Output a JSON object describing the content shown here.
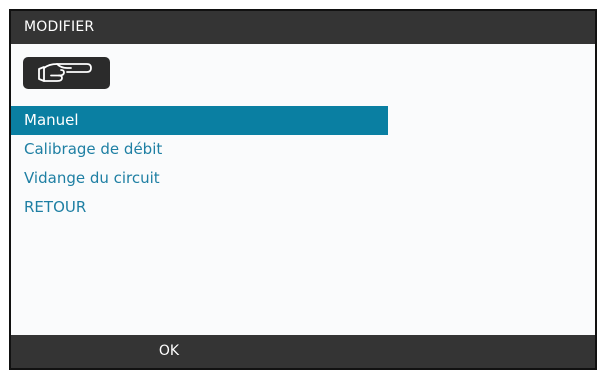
{
  "header": {
    "title": "MODIFIER"
  },
  "mode_icon": {
    "icon": "pointing-hand-icon"
  },
  "menu": {
    "items": [
      {
        "label": "Manuel",
        "selected": true
      },
      {
        "label": "Calibrage de débit",
        "selected": false
      },
      {
        "label": "Vidange du circuit",
        "selected": false
      },
      {
        "label": "RETOUR",
        "selected": false
      }
    ]
  },
  "footer": {
    "ok_label": "OK"
  },
  "colors": {
    "bar_background": "#343434",
    "selection": "#0a7fa2",
    "menu_text": "#1e7fa3",
    "screen_background": "#fafbfc"
  }
}
